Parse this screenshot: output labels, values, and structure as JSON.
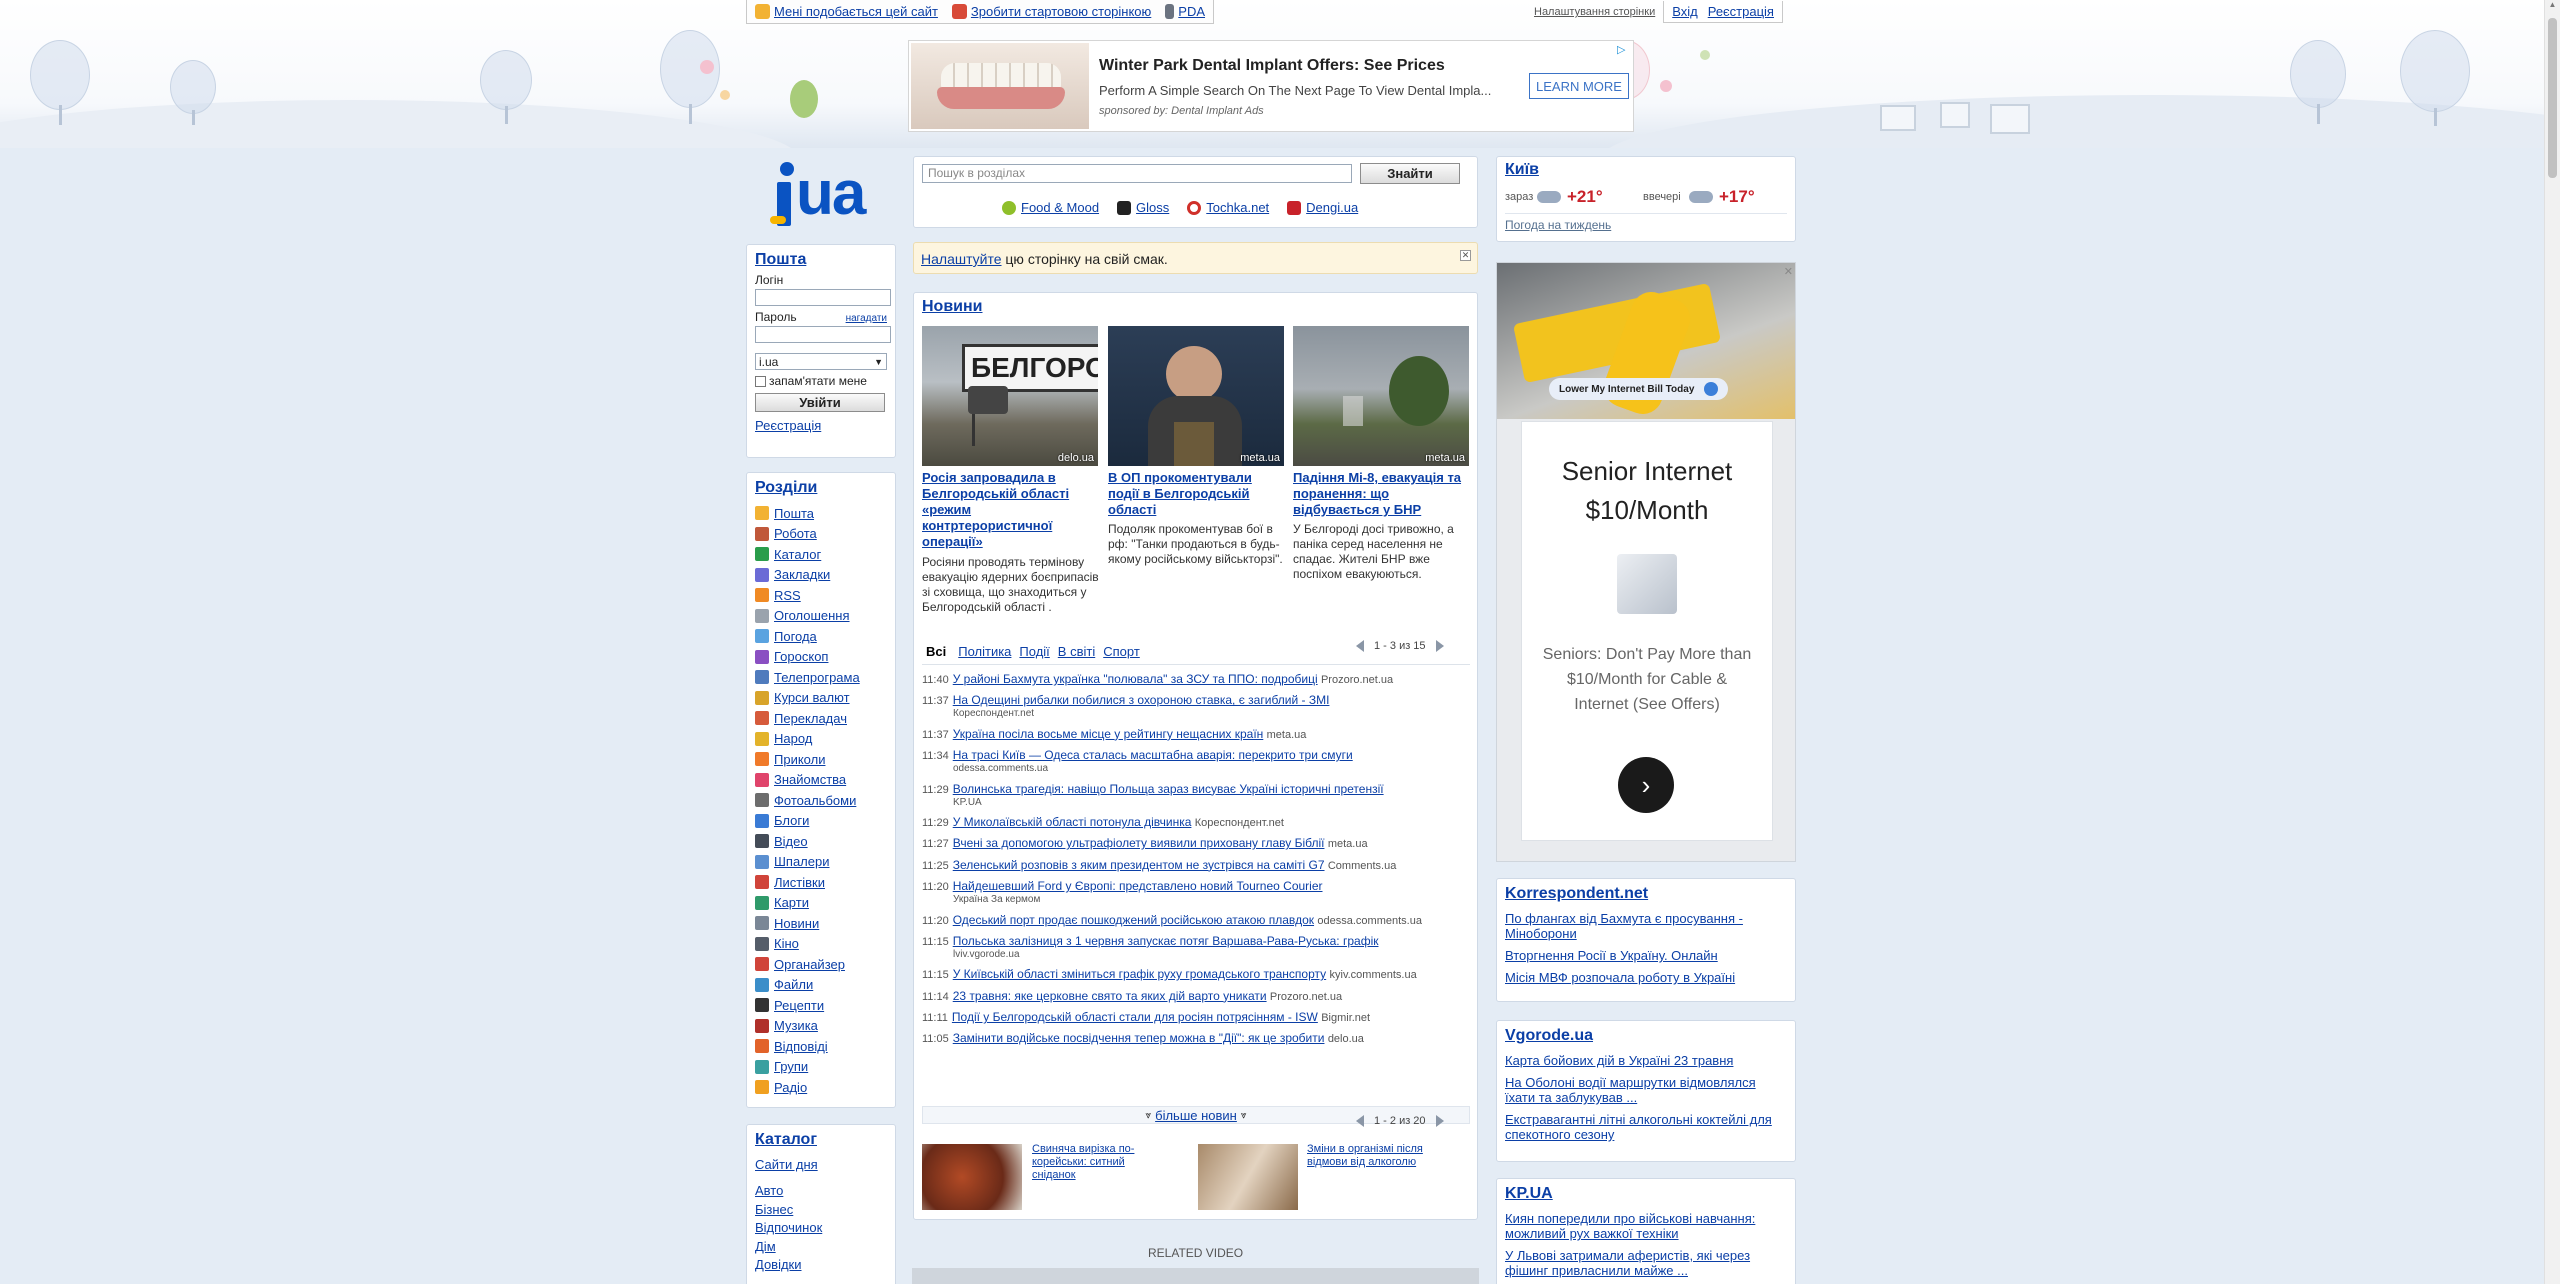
{
  "top_links": {
    "like": "Мені подобається цей сайт",
    "homepage": "Зробити стартовою сторінкою",
    "pda": "PDA",
    "settings": "Налаштування сторінки",
    "login": "Вхід",
    "register": "Реєстрація"
  },
  "top_ad": {
    "title": "Winter Park Dental Implant Offers: See Prices",
    "desc": "Perform A Simple Search On The Next Page To View Dental Impla...",
    "sponsor": "sponsored by: Dental Implant Ads",
    "cta": "LEARN MORE"
  },
  "mail": {
    "title": "Пошта",
    "login_label": "Логін",
    "password_label": "Пароль",
    "remind": "нагадати",
    "domain": "i.ua",
    "remember": "запам'ятати мене",
    "submit": "Увійти",
    "register": "Реєстрація"
  },
  "sections": {
    "title": "Розділи",
    "items": [
      {
        "label": "Пошта",
        "color": "#f2b233"
      },
      {
        "label": "Робота",
        "color": "#c0583a"
      },
      {
        "label": "Каталог",
        "color": "#2a9d4b"
      },
      {
        "label": "Закладки",
        "color": "#6b6bd6"
      },
      {
        "label": "RSS",
        "color": "#f08a24"
      },
      {
        "label": "Оголошення",
        "color": "#9aa3ad"
      },
      {
        "label": "Погода",
        "color": "#5aa3e0"
      },
      {
        "label": "Гороскоп",
        "color": "#8a4fc2"
      },
      {
        "label": "Телепрограма",
        "color": "#4f7bbd"
      },
      {
        "label": "Курси валют",
        "color": "#d8a42a"
      },
      {
        "label": "Перекладач",
        "color": "#d65b3b"
      },
      {
        "label": "Народ",
        "color": "#e3b32a"
      },
      {
        "label": "Приколи",
        "color": "#f07a2a"
      },
      {
        "label": "Знайомства",
        "color": "#e0446b"
      },
      {
        "label": "Фотоальбоми",
        "color": "#6d6d6d"
      },
      {
        "label": "Блоги",
        "color": "#3a7bd5"
      },
      {
        "label": "Відео",
        "color": "#444c58"
      },
      {
        "label": "Шпалери",
        "color": "#5b8fd0"
      },
      {
        "label": "Листівки",
        "color": "#d0443a"
      },
      {
        "label": "Карти",
        "color": "#2f9a6a"
      },
      {
        "label": "Новини",
        "color": "#7a8796"
      },
      {
        "label": "Кіно",
        "color": "#555d69"
      },
      {
        "label": "Органайзер",
        "color": "#d0443a"
      },
      {
        "label": "Файли",
        "color": "#3b8ec9"
      },
      {
        "label": "Рецепти",
        "color": "#333333"
      },
      {
        "label": "Музика",
        "color": "#b0302a"
      },
      {
        "label": "Відповіді",
        "color": "#e2632a"
      },
      {
        "label": "Групи",
        "color": "#3aa0a0"
      },
      {
        "label": "Радіо",
        "color": "#f0a020"
      }
    ]
  },
  "catalog": {
    "title": "Каталог",
    "site_of_day": "Сайти дня",
    "items": [
      "Авто",
      "Бізнес",
      "Відпочинок",
      "Дім",
      "Довідки"
    ]
  },
  "search": {
    "placeholder": "Пошук в розділах",
    "button": "Знайти",
    "partners": [
      "Food & Mood",
      "Gloss",
      "Tochka.net",
      "Dengi.ua"
    ]
  },
  "customize": {
    "link": "Налаштуйте",
    "text": " цю сторінку на свій смак."
  },
  "news": {
    "title": "Новини",
    "top": [
      {
        "source": "delo.ua",
        "headline": "Росія запровадила в Белгородській області «режим контртерористичної операції»",
        "lead": "Росіяни проводять термінову евакуацію ядерних боєприпасів зі сховища, що знаходиться у Белгородській області .",
        "sign": "БЕЛГОРОД"
      },
      {
        "source": "meta.ua",
        "headline": "В ОП прокоментували події в Белгородській області",
        "lead": "Подоляк прокоментував бої в рф: \"Танки продаються в будь-якому російському військторзі\"."
      },
      {
        "source": "meta.ua",
        "headline": "Падіння Мі-8, евакуація та поранення: що відбувається у БНР",
        "lead": "У Бєлгороді досі тривожно, а паніка серед населення не спадає. Жителі БНР вже поспіхом евакуюються."
      }
    ],
    "top_pager": "1 - 3 из 15",
    "tabs": [
      "Всі",
      "Політика",
      "Події",
      "В світі",
      "Спорт"
    ],
    "feed": [
      {
        "time": "11:40",
        "title": "У районі Бахмута українка \"полювала\" за ЗСУ та ППО: подробиці",
        "source": "Prozoro.net.ua",
        "inline": true
      },
      {
        "time": "11:37",
        "title": "На Одещині рибалки побилися з охороною ставка, є загиблий - ЗМІ",
        "source": "Кореспондент.net",
        "inline": false
      },
      {
        "time": "11:37",
        "title": "Україна посіла восьме місце у рейтингу нещасних країн",
        "source": "meta.ua",
        "inline": true
      },
      {
        "time": "11:34",
        "title": "На трасі Київ — Одеса сталась масштабна аварія: перекрито три смуги",
        "source": "odessa.comments.ua",
        "inline": false
      },
      {
        "time": "11:29",
        "title": "Волинська трагедія: навіщо Польща зараз висуває Україні історичні претензії",
        "source": "KP.UA",
        "inline": false
      },
      {
        "time": "11:29",
        "title": "У Миколаївській області потонула дівчинка",
        "source": "Кореспондент.net",
        "inline": true
      },
      {
        "time": "11:27",
        "title": "Вчені за допомогою ультрафіолету виявили приховану главу Біблії",
        "source": "meta.ua",
        "inline": true
      },
      {
        "time": "11:25",
        "title": "Зеленський розповів з яким президентом не зустрівся на саміті G7",
        "source": "Comments.ua",
        "inline": true
      },
      {
        "time": "11:20",
        "title": "Найдешевший Ford у Європі: представлено новий Tourneo Courier",
        "source": "Україна За кермом",
        "inline": false
      },
      {
        "time": "11:20",
        "title": "Одеський порт продає пошкоджений російською атакою плавдок",
        "source": "odessa.comments.ua",
        "inline": true
      },
      {
        "time": "11:15",
        "title": "Польська залізниця з 1 червня запускає потяг Варшава-Рава-Руська: графік",
        "source": "lviv.vgorode.ua",
        "inline": false
      },
      {
        "time": "11:15",
        "title": "У Київській області зміниться графік руху громадського транспорту",
        "source": "kyiv.comments.ua",
        "inline": true
      },
      {
        "time": "11:14",
        "title": "23 травня: яке церковне свято та яких дій варто уникати",
        "source": "Prozoro.net.ua",
        "inline": true
      },
      {
        "time": "11:11",
        "title": "Події у Белгородській області стали для росіян потрясінням - ISW",
        "source": "Bigmir.net",
        "inline": true
      },
      {
        "time": "11:05",
        "title": "Замінити водійське посвідчення тепер можна в \"Дії\": як це зробити",
        "source": "delo.ua",
        "inline": true
      }
    ],
    "more": "більше новин",
    "bottom_pager": "1 - 2 из 20",
    "promos": [
      {
        "title": "Свиняча вирізка по-корейськи: ситний сніданок"
      },
      {
        "title": "Зміни в організмі після відмови від алкоголю"
      }
    ],
    "related": "RELATED VIDEO"
  },
  "weather": {
    "city": "Київ",
    "now_label": "зараз",
    "now_temp": "+21°",
    "evening_label": "ввечері",
    "evening_temp": "+17°",
    "week": "Погода на тиждень"
  },
  "side_ad": {
    "banner_cta": "Lower My Internet Bill Today",
    "title": "Senior Internet $10/Month",
    "desc": "Seniors: Don't Pay More than $10/Month for Cable & Internet (See Offers)"
  },
  "korrespondent": {
    "title": "Korrespondent.net",
    "links": [
      "По флангах від Бахмута є просування - Міноборони",
      "Вторгнення Росії в Україну. Онлайн",
      "Місія МВФ розпочала роботу в Україні"
    ]
  },
  "vgorode": {
    "title": "Vgorode.ua",
    "links": [
      "Карта бойових дій в Україні 23 травня",
      "На Оболоні водії маршрутки відмовлялся їхати та заблукував ...",
      "Екстравагантні літні алкогольні коктейлі для спекотного сезону"
    ]
  },
  "kpua": {
    "title": "KP.UA",
    "links": [
      "Киян попередили про військові навчання: можливий рух важкої техніки",
      "У Львові затримали аферистів, які через фішинг привласнили майже ..."
    ]
  }
}
